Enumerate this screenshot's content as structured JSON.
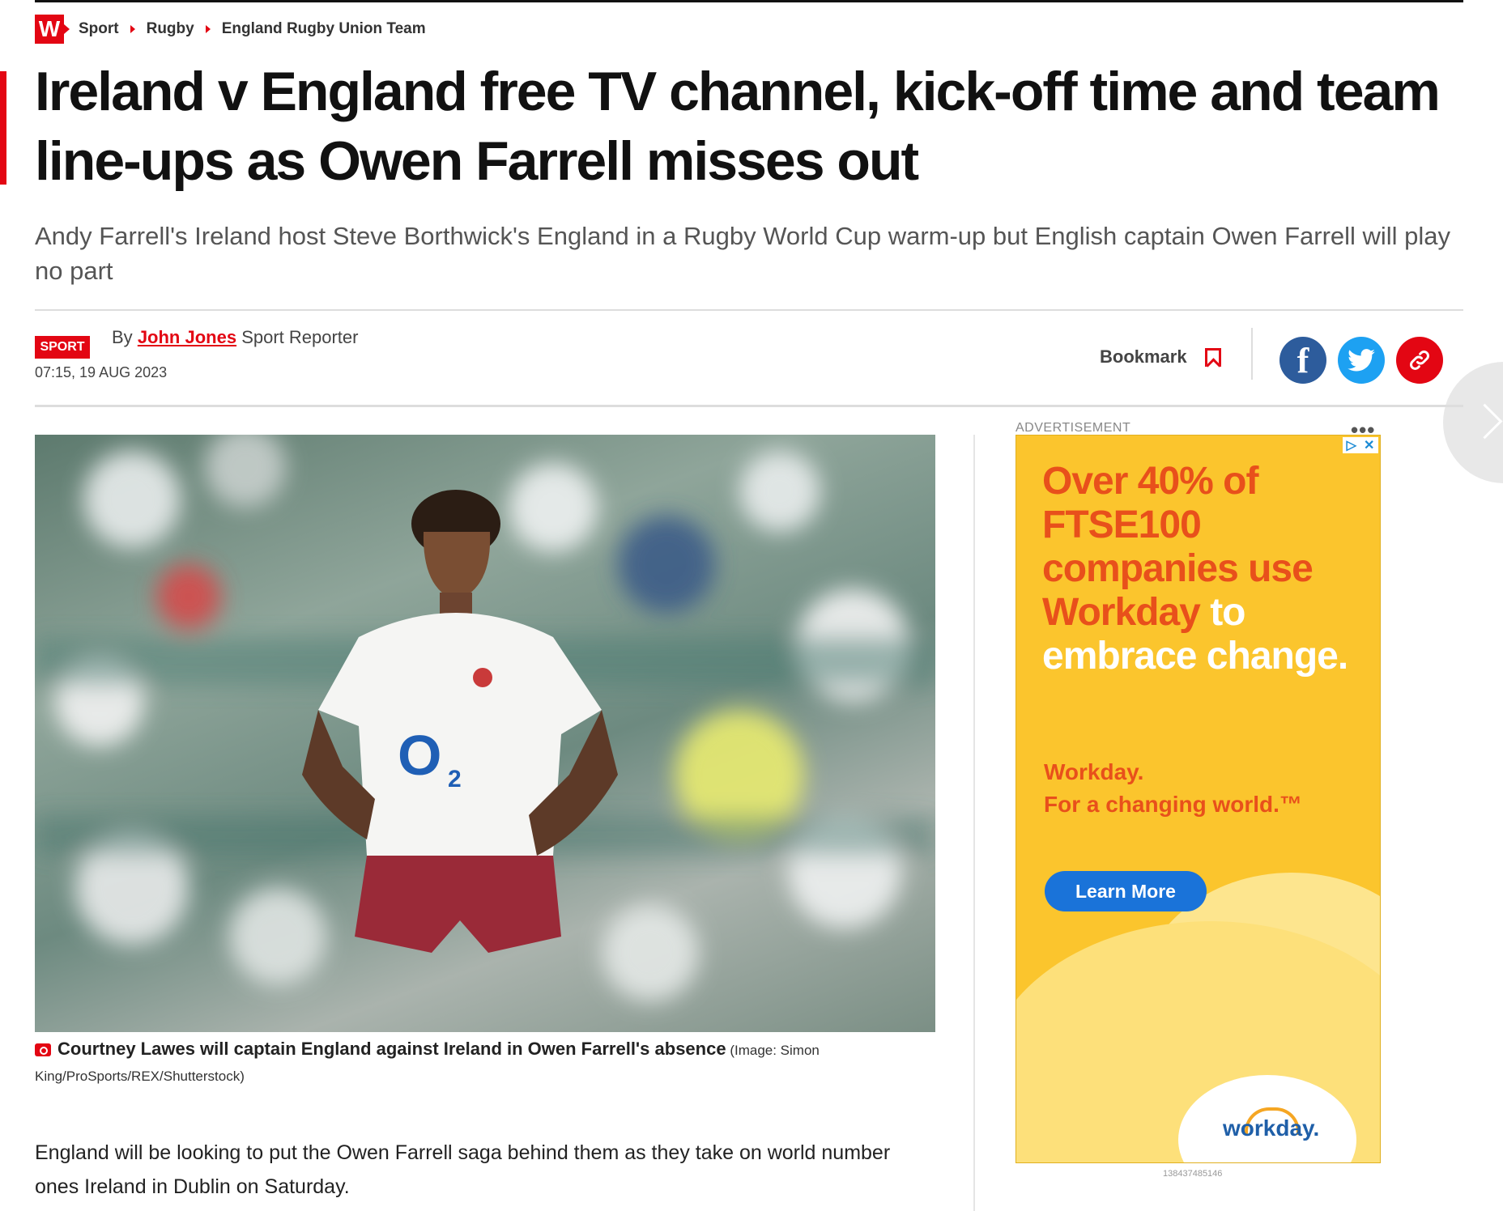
{
  "breadcrumb": {
    "logo": "W",
    "items": [
      "Sport",
      "Rugby",
      "England Rugby Union Team"
    ]
  },
  "article": {
    "headline": "Ireland v England free TV channel, kick-off time and team line-ups as Owen Farrell misses out",
    "standfirst": "Andy Farrell's Ireland host Steve Borthwick's England in a Rugby World Cup warm-up but English captain Owen Farrell will play no part",
    "section_tag": "SPORT",
    "byline_prefix": "By",
    "author": "John Jones",
    "author_role": "Sport Reporter",
    "timestamp": "07:15, 19 AUG 2023",
    "bookmark_label": "Bookmark",
    "image_caption": "Courtney Lawes will captain England against Ireland in Owen Farrell's absence",
    "image_credit": "(Image: Simon King/ProSports/REX/Shutterstock)",
    "body_paragraph": "England will be looking to put the Owen Farrell saga behind them as they take on world number ones Ireland in Dublin on Saturday."
  },
  "share": {
    "icons": [
      "facebook-icon",
      "twitter-icon",
      "link-icon"
    ],
    "colors": {
      "facebook": "#2d5c9c",
      "twitter": "#1da1f2",
      "link": "#e30613"
    }
  },
  "advert": {
    "label": "ADVERTISEMENT",
    "menu": "•••",
    "headline_orange": "Over 40% of FTSE100 companies use Workday",
    "headline_white": "to embrace change.",
    "tagline_1": "Workday.",
    "tagline_2": "For a changing world.™",
    "cta": "Learn More",
    "brand": "workday.",
    "id": "138437485146"
  },
  "colors": {
    "accent": "#e30613",
    "ad_background": "#fbc52d",
    "ad_text": "#e8501b",
    "ad_button": "#1a73d9"
  }
}
